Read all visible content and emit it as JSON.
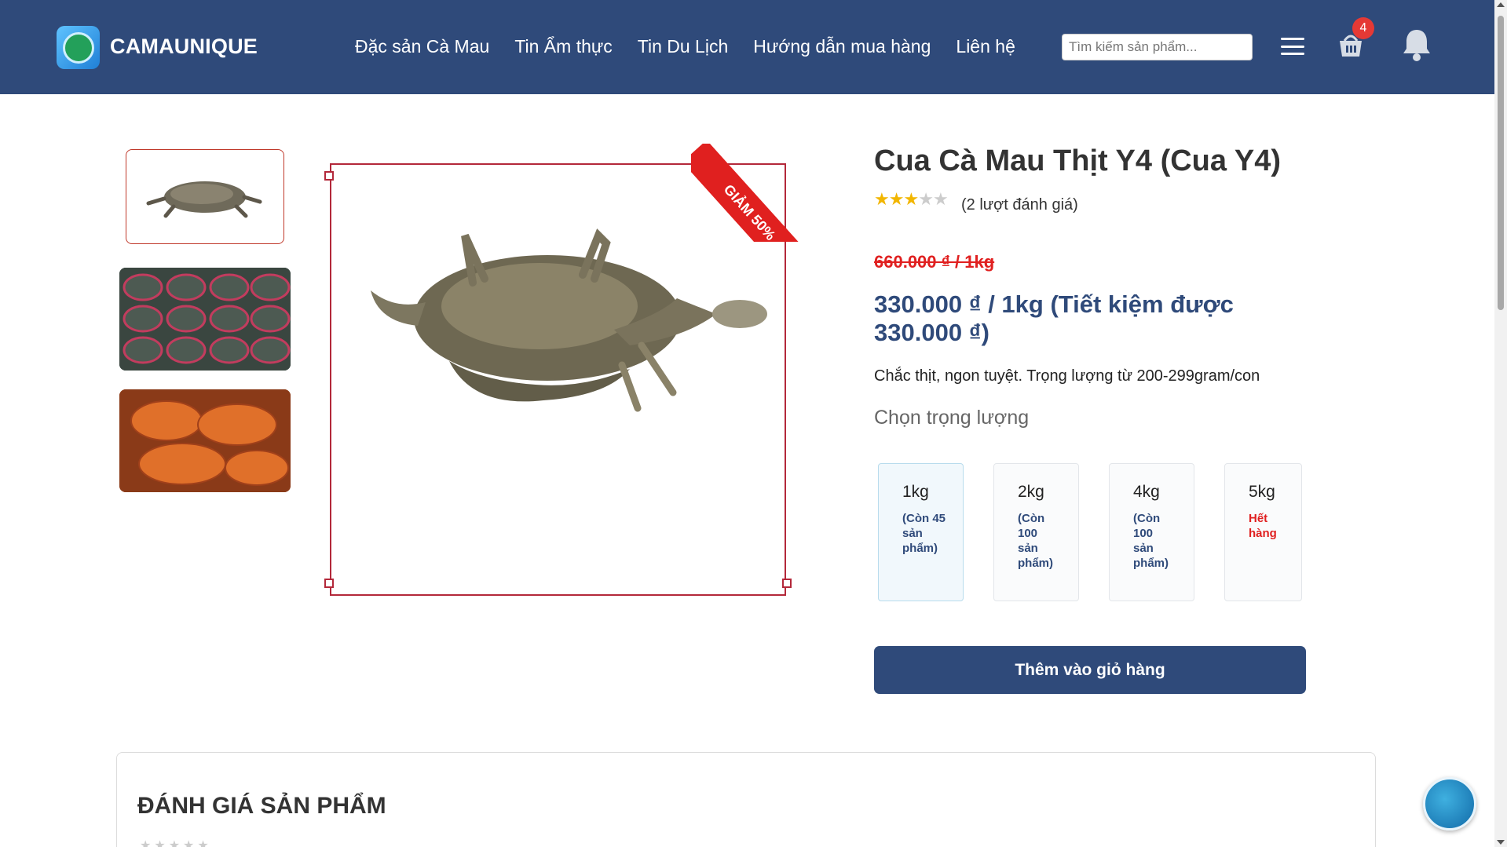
{
  "header": {
    "brand": "CAMAUNIQUE",
    "nav": [
      "Đặc sản Cà Mau",
      "Tin Ẩm thực",
      "Tin Du Lịch",
      "Hướng dẫn mua hàng",
      "Liên hệ"
    ],
    "search_placeholder": "Tìm kiếm sản phẩm...",
    "cart_count": "4",
    "color": "#2f4a7a"
  },
  "gallery": {
    "discount_badge": "GIẢM 50%"
  },
  "product": {
    "title": "Cua Cà Mau Thịt Y4 (Cua Y4)",
    "rating": 3,
    "rating_max": 5,
    "rating_count": "(2 lượt đánh giá)",
    "old_price": "660.000 ₫ / 1kg",
    "new_price": "330.000 ₫ / 1kg (Tiết kiệm được 330.000 ₫)",
    "description": "Chắc thịt, ngon tuyệt. Trọng lượng từ 200-299gram/con",
    "choose_weight_label": "Chọn trọng lượng",
    "weights": [
      {
        "label": "1kg",
        "stock": "(Còn 45 sản phẩm)",
        "selected": true
      },
      {
        "label": "2kg",
        "stock": "(Còn 100 sản phẩm)",
        "selected": false
      },
      {
        "label": "4kg",
        "stock": "(Còn 100 sản phẩm)",
        "selected": false
      },
      {
        "label": "5kg",
        "stock": "Hết hàng",
        "selected": false
      }
    ],
    "add_to_cart": "Thêm vào giỏ hàng"
  },
  "reviews": {
    "title": "ĐÁNH GIÁ SẢN PHẨM",
    "stars": "★★★★★"
  }
}
